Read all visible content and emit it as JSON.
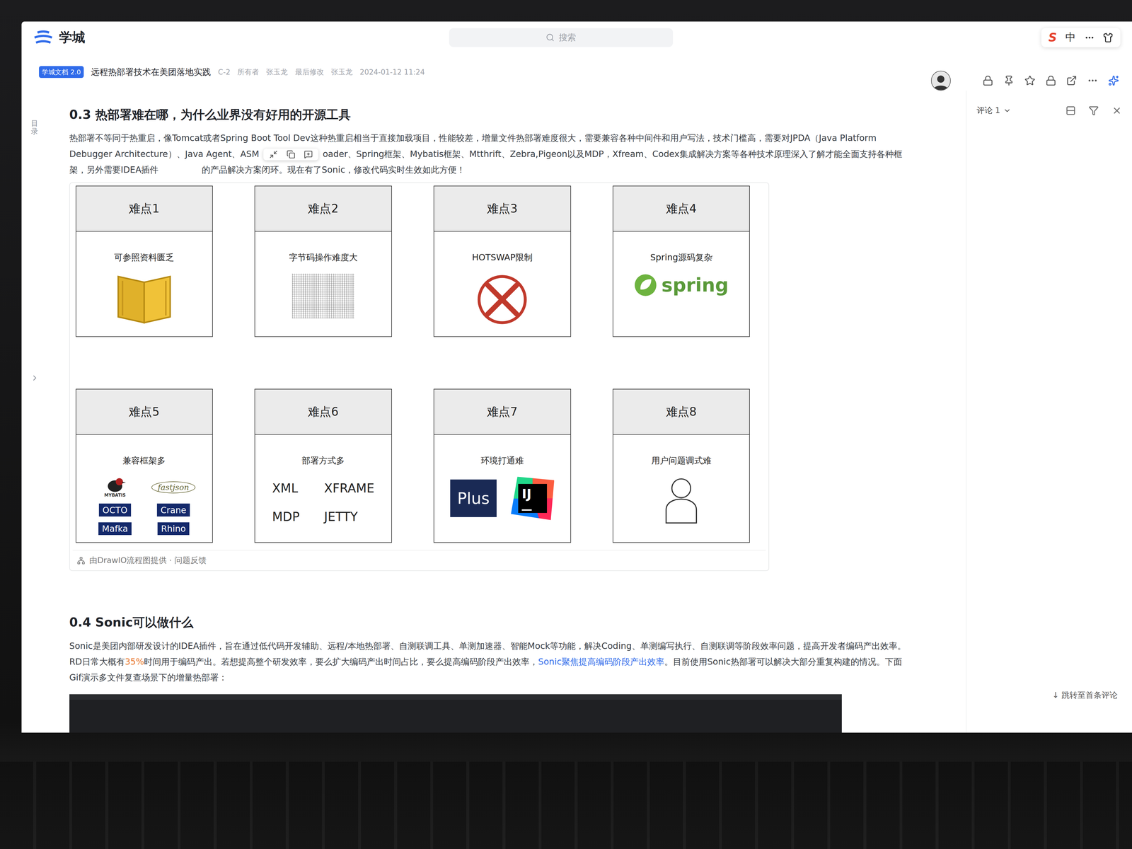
{
  "app": {
    "logo": "学城",
    "search": {
      "placeholder": "搜索"
    },
    "ime": {
      "brand": "S",
      "mode": "中"
    }
  },
  "doc": {
    "badge": "学城文档 2.0",
    "title": "远程热部署技术在美团落地实践",
    "version": "C-2",
    "owner_label": "所有者",
    "owner": "张玉龙",
    "modified_label": "最后修改",
    "modified_by": "张玉龙",
    "modified_at": "2024-01-12 11:24"
  },
  "outline_label": "目录",
  "section1": {
    "heading": "0.3 热部署难在哪，为什么业界没有好用的开源工具",
    "segments": [
      "热部署不等同于热重启，像Tomcat或者Spring Boot Tool Dev这种热重启相当于直接加载项目，性能较差，增量文件热部署难度很大，需要兼容各种中间件和用户写法，技术门槛高，需要对JPDA（Java Platform Debugger Architecture）、Java Agent、ASM",
      "oader、Spring框架、Mybatis框架、Mtthrift、Zebra,Pigeon以及MDP，Xfream、Codex集成解决方案等各种技术原理深入了解才能全面支持各种框架，另外需要IDEA插件",
      "的产品解决方案闭环。现在有了Sonic，修改代码实时生效如此方便！"
    ],
    "cards": [
      {
        "title": "难点1",
        "subtitle": "可参照资料匮乏",
        "kind": "book"
      },
      {
        "title": "难点2",
        "subtitle": "字节码操作难度大",
        "kind": "bytecode"
      },
      {
        "title": "难点3",
        "subtitle": "HOTSWAP限制",
        "kind": "forbidden"
      },
      {
        "title": "难点4",
        "subtitle": "Spring源码复杂",
        "kind": "spring",
        "logo": "spring"
      },
      {
        "title": "难点5",
        "subtitle": "兼容框架多",
        "kind": "logos",
        "logos": [
          {
            "label": "MYBATIS",
            "kind": "bird"
          },
          {
            "label": "fastjson",
            "kind": "script"
          },
          {
            "label": "OCTO",
            "kind": "tag"
          },
          {
            "label": "Crane",
            "kind": "tag"
          },
          {
            "label": "Mafka",
            "kind": "tag"
          },
          {
            "label": "Rhino",
            "kind": "tag"
          }
        ]
      },
      {
        "title": "难点6",
        "subtitle": "部署方式多",
        "kind": "words",
        "words": [
          "XML",
          "XFRAME",
          "MDP",
          "JETTY"
        ]
      },
      {
        "title": "难点7",
        "subtitle": "环境打通难",
        "kind": "apps",
        "apps": [
          {
            "label": "Plus",
            "kind": "plus"
          },
          {
            "label": "IJ",
            "kind": "intellij"
          }
        ]
      },
      {
        "title": "难点8",
        "subtitle": "用户问题调式难",
        "kind": "person"
      }
    ],
    "caption": "由DrawIO流程图提供 · 问题反馈"
  },
  "section2": {
    "heading": "0.4 Sonic可以做什么",
    "paragraph": [
      {
        "text": "Sonic是美团内部研发设计的IDEA插件，旨在通过低代码开发辅助、远程/本地热部署、自测联调工具、单测加速器、智能Mock等功能，解决Coding、单测编写执行、自测联调等阶段效率问题，提高开发者编码产出效率。RD日常大概有",
        "kind": "plain"
      },
      {
        "text": "35%",
        "kind": "highlight"
      },
      {
        "text": "时间用于编码产出。若想提高整个研发效率，要么扩大编码产出时间占比，要么提高编码阶段产出效率，",
        "kind": "plain"
      },
      {
        "text": "Sonic聚焦提高编码阶段产出效率",
        "kind": "link"
      },
      {
        "text": "。目前使用Sonic热部署可以解决大部分重复构建的情况。下面Gif演示多文件复查场景下的增量热部署：",
        "kind": "plain"
      }
    ]
  },
  "comments": {
    "label": "评论 1",
    "jump": "↓ 跳转至首条评论"
  }
}
